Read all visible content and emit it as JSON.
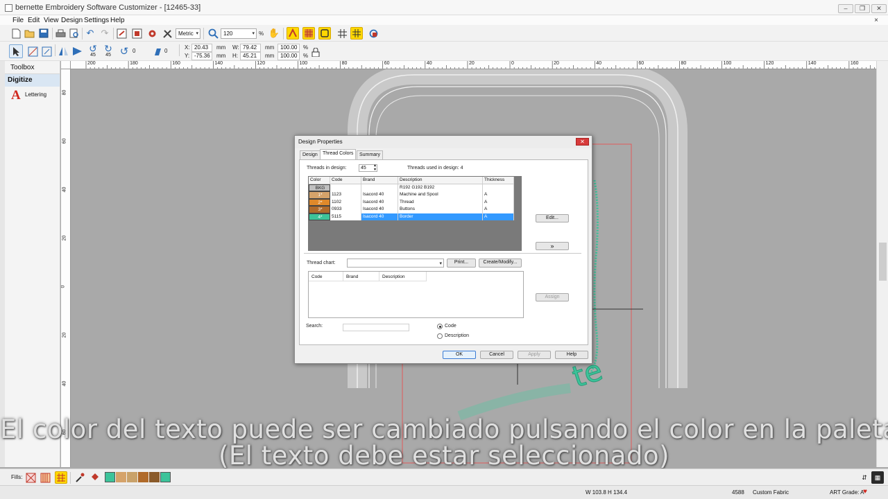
{
  "window": {
    "title": "bernette Embroidery Software Customizer - [12465-33]",
    "min_glyph": "‒",
    "restore_glyph": "❐",
    "close_glyph": "✕"
  },
  "menu": {
    "items": [
      "File",
      "Edit",
      "View",
      "Design",
      "Settings",
      "Help"
    ],
    "close_glyph": "×"
  },
  "toolbar": {
    "units": "Metric",
    "zoom": "120",
    "zoom_unit": "%",
    "rotate_labels": [
      "45",
      "45"
    ],
    "rotate_value": "0",
    "skew_value": "0",
    "x_label": "X:",
    "x_value": "20.43",
    "y_label": "Y:",
    "y_value": "-75.36",
    "mm": "mm",
    "w_label": "W:",
    "w_value": "79.42",
    "h_label": "H:",
    "h_value": "45.21",
    "sw_value": "100.00",
    "sh_value": "100.00",
    "pct": "%"
  },
  "toolbox": {
    "title": "Toolbox",
    "section": "Digitize",
    "tool_glyph": "A",
    "tool_label": "Lettering"
  },
  "ruler": {
    "h_ticks": [
      "200",
      "180",
      "160",
      "140",
      "120",
      "100",
      "80",
      "60",
      "40",
      "20",
      "0",
      "20",
      "40",
      "60",
      "80",
      "100",
      "120",
      "140",
      "160"
    ],
    "v_ticks": [
      "80",
      "60",
      "40",
      "20",
      "0",
      "20",
      "40",
      "60"
    ]
  },
  "dialog": {
    "title": "Design Properties",
    "close_glyph": "✕",
    "tabs": [
      "Design",
      "Thread Colors",
      "Summary"
    ],
    "threads_in_design_label": "Threads in design:",
    "threads_in_design_value": "45",
    "threads_used_label": "Threads used in design: 4",
    "columns": [
      "Color",
      "Code",
      "Brand",
      "Description",
      "Thickness"
    ],
    "rows": [
      {
        "color": "BKG",
        "code": "",
        "brand": "",
        "description": "R192 G192 B192",
        "thickness": ""
      },
      {
        "color": "1*",
        "code": "1123",
        "brand": "Isacord 40",
        "description": "Machine and Spool",
        "thickness": "A"
      },
      {
        "color": "2*",
        "code": "1102",
        "brand": "Isacord 40",
        "description": "Thread",
        "thickness": "A"
      },
      {
        "color": "3*",
        "code": "0933",
        "brand": "Isacord 40",
        "description": "Buttons",
        "thickness": "A"
      },
      {
        "color": "4*",
        "code": "5115",
        "brand": "Isacord 40",
        "description": "Border",
        "thickness": "A"
      }
    ],
    "row_colors": [
      "#c0c0c0",
      "#d5a36a",
      "#e0892a",
      "#b06a2a",
      "#3cc39a"
    ],
    "edit_button": "Edit...",
    "expand_glyph": "»",
    "thread_chart_label": "Thread chart:",
    "thread_chart_value": "",
    "print_button": "Print...",
    "create_modify_button": "Create/Modify...",
    "chart_columns": [
      "Code",
      "Brand",
      "Description"
    ],
    "assign_button": "Assign",
    "search_label": "Search:",
    "search_value": "",
    "radio_code": "Code",
    "radio_description": "Description",
    "ok": "OK",
    "cancel": "Cancel",
    "apply": "Apply",
    "help": "Help"
  },
  "canvas": {
    "lettering_text": "te"
  },
  "fills": {
    "label": "Fills:",
    "palette": [
      "#3cc39a",
      "#d5a36a",
      "#c9a26a",
      "#b06a2a",
      "#8a5a2a",
      "#3cc39a"
    ]
  },
  "status": {
    "size": "W 103.8 H 134.4",
    "stitches": "4588",
    "fabric": "Custom Fabric",
    "grade": "ART Grade: A",
    "heart": "♥"
  },
  "subtitle": {
    "line1": "El color del texto puede ser cambiado pulsando el color en la paleta",
    "line2": "(El texto debe estar seleccionado)"
  },
  "colors": {
    "accent": "#3399ff",
    "selection_highlight": "#ffd800"
  }
}
